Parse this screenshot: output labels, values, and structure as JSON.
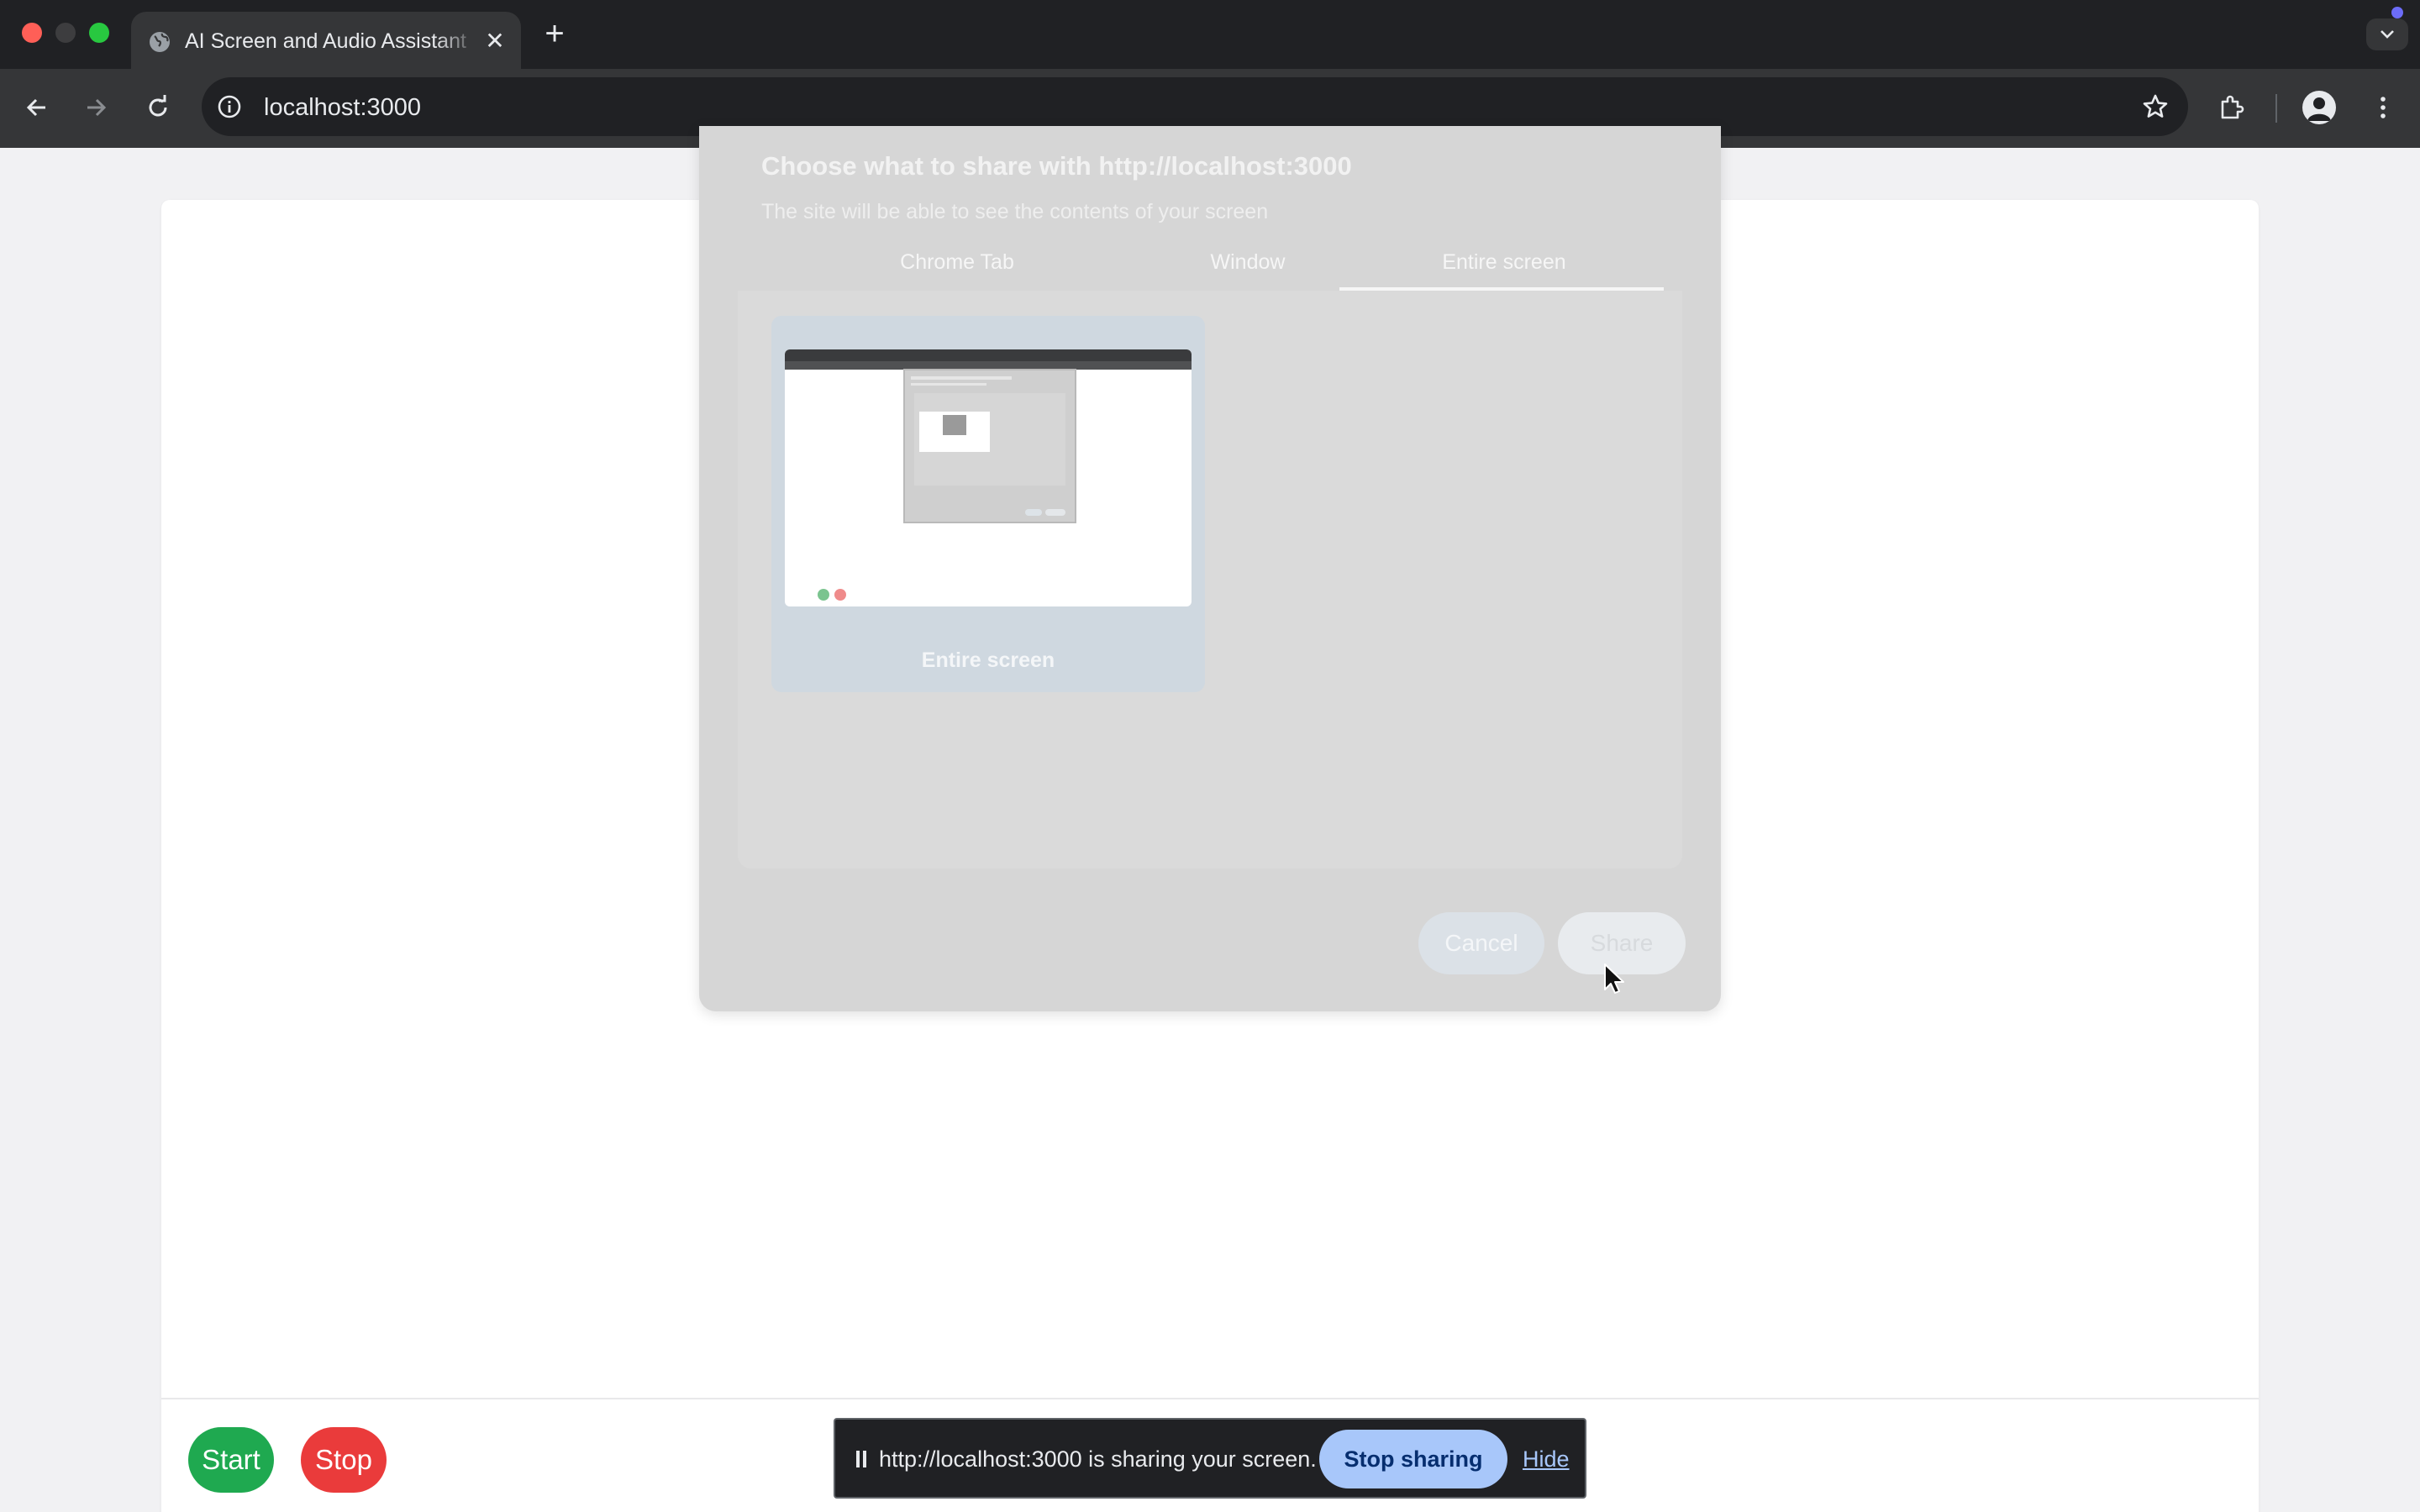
{
  "browser": {
    "tab_title": "AI Screen and Audio Assistant",
    "url": "localhost:3000",
    "icons": {
      "tab_favicon": "globe-icon",
      "tab_close": "close-icon",
      "new_tab": "plus-icon",
      "tab_search": "chevron-down-icon",
      "back": "arrow-left-icon",
      "forward": "arrow-right-icon",
      "reload": "reload-icon",
      "site_info": "info-icon",
      "bookmark": "star-icon",
      "extensions": "puzzle-icon",
      "profile": "person-icon",
      "menu": "kebab-menu-icon"
    },
    "glyphs": {
      "close": "✕",
      "plus": "+"
    }
  },
  "share_dialog": {
    "title": "Choose what to share with http://localhost:3000",
    "subtitle": "The site will be able to see the contents of your screen",
    "tabs": [
      "Chrome Tab",
      "Window",
      "Entire screen"
    ],
    "selected_tab": "Entire screen",
    "source_label": "Entire screen",
    "cancel_label": "Cancel",
    "share_label": "Share"
  },
  "app": {
    "start_label": "Start",
    "stop_label": "Stop",
    "colors": {
      "start": "#1fa950",
      "stop": "#ea3b3b"
    }
  },
  "sharing_bar": {
    "message": "http://localhost:3000 is sharing your screen.",
    "stop_label": "Stop sharing",
    "hide_label": "Hide",
    "pause_icon": "pause-icon"
  }
}
